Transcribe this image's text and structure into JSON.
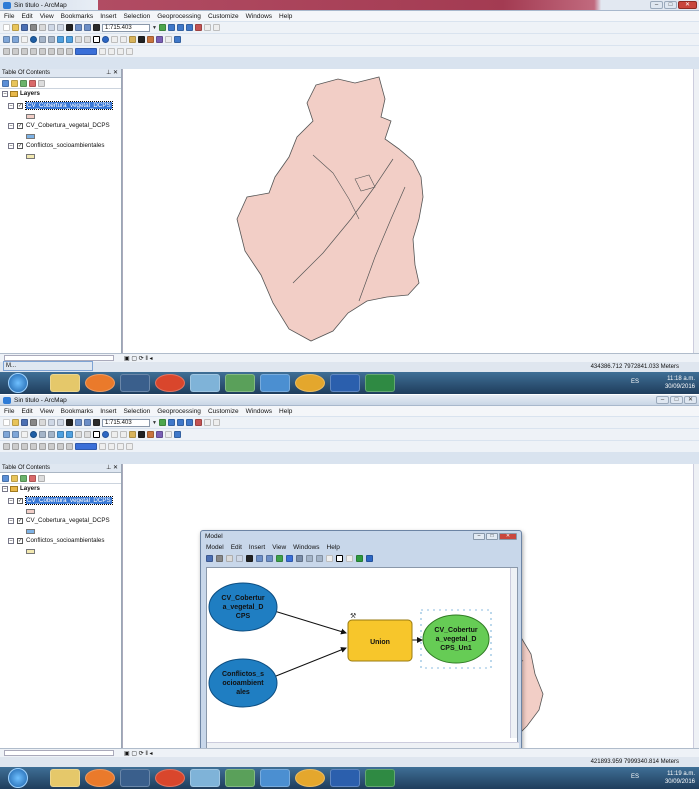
{
  "colors": {
    "accent": "#3a79d6",
    "polygon_fill": "#f2cec6",
    "polygon_stroke": "#555",
    "node_input": "#1f7ec2",
    "node_tool": "#f7c62b",
    "node_output": "#66cc55"
  },
  "screenshots": [
    {
      "title": "Sin titulo - ArcMap",
      "menu": [
        "File",
        "Edit",
        "View",
        "Bookmarks",
        "Insert",
        "Selection",
        "Geoprocessing",
        "Customize",
        "Windows",
        "Help"
      ],
      "scale": "1:715.403",
      "toc": {
        "title": "Table Of Contents",
        "group": "Layers",
        "layers": [
          {
            "name": "CV_Cobertura_vegetal_DCPS",
            "selected": true,
            "swatch": "#f2cec6"
          },
          {
            "name": "CV_Cobertura_vegetal_DCPS",
            "selected": false,
            "swatch": "#7eb3e6"
          },
          {
            "name": "Conflictos_socioambientales",
            "selected": false,
            "swatch": "#f2e8b0"
          }
        ]
      },
      "status_coords": "434386.712  7972841.033 Meters",
      "mini_tab": "M...",
      "clock": {
        "time": "11:18 a.m.",
        "date": "30/09/2016"
      },
      "tray_lang": "ES"
    },
    {
      "title": "Sin titulo - ArcMap",
      "menu": [
        "File",
        "Edit",
        "View",
        "Bookmarks",
        "Insert",
        "Selection",
        "Geoprocessing",
        "Customize",
        "Windows",
        "Help"
      ],
      "scale": "1:715.403",
      "toc": {
        "title": "Table Of Contents",
        "group": "Layers",
        "layers": [
          {
            "name": "CV_Cobertura_vegetal_DCPS",
            "selected": true,
            "swatch": "#f2cec6"
          },
          {
            "name": "CV_Cobertura_vegetal_DCPS",
            "selected": false,
            "swatch": "#7eb3e6"
          },
          {
            "name": "Conflictos_socioambientales",
            "selected": false,
            "swatch": "#f2e8b0"
          }
        ]
      },
      "status_coords": "421893.959  7999340.814 Meters",
      "clock": {
        "time": "11:19 a.m.",
        "date": "30/09/2016"
      },
      "tray_lang": "ES",
      "model": {
        "title": "Model",
        "menu": [
          "Model",
          "Edit",
          "Insert",
          "View",
          "Windows",
          "Help"
        ],
        "nodes": {
          "input1": [
            "CV_Cobertur",
            "a_vegetal_D",
            "CPS"
          ],
          "input2": [
            "Conflictos_s",
            "ocioambient",
            "ales"
          ],
          "tool": "Union",
          "output": [
            "CV_Cobertur",
            "a_vegetal_D",
            "CPS_Un1"
          ]
        }
      }
    }
  ]
}
